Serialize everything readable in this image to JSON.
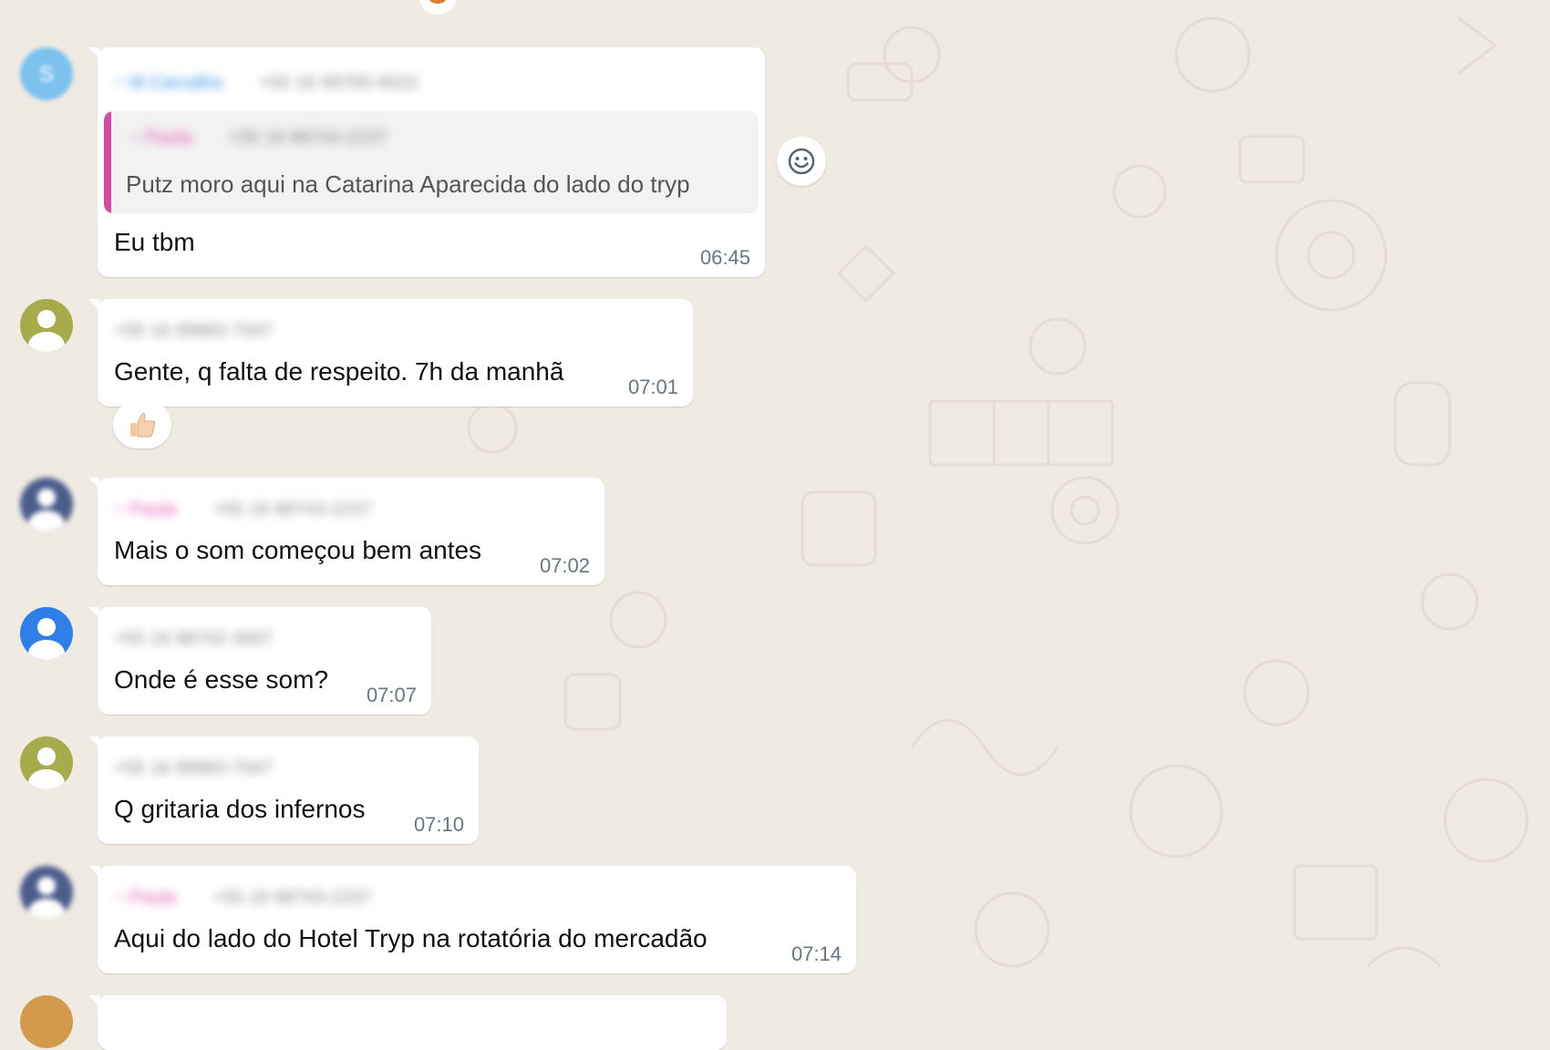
{
  "chat": {
    "messages": [
      {
        "id": 1,
        "sender_name": "~ M Carvalho",
        "sender_phone": "+55 16 99765-9022",
        "quote": {
          "author": "~ Paula",
          "author_phone": "+55 16 98743-2237",
          "text": "Putz moro aqui na Catarina Aparecida do lado do tryp"
        },
        "text": "Eu tbm",
        "time": "06:45"
      },
      {
        "id": 2,
        "sender_phone": "+55 16 99983-7047",
        "text": "Gente, q falta de respeito. 7h da manhã",
        "time": "07:01",
        "reaction": "thumbs-up"
      },
      {
        "id": 3,
        "sender_name": "~ Paula",
        "sender_phone": "+55 16 98743-2237",
        "text": "Mais o som começou bem antes",
        "time": "07:02"
      },
      {
        "id": 4,
        "sender_phone": "+55 16 98742-3007",
        "text": "Onde é esse som?",
        "time": "07:07"
      },
      {
        "id": 5,
        "sender_phone": "+55 16 99983-7047",
        "text": "Q gritaria dos infernos",
        "time": "07:10"
      },
      {
        "id": 6,
        "sender_name": "~ Paula",
        "sender_phone": "+55 16 98743-2237",
        "text": "Aqui do lado do Hotel Tryp na rotatória do mercadão",
        "time": "07:14"
      }
    ]
  },
  "colors": {
    "background": "#efeae2",
    "bubble": "#ffffff",
    "quote_accent": "#d44ba3",
    "time_text": "#667781"
  },
  "icons": {
    "react": "smiley-icon",
    "reaction": "thumbs-up-icon"
  }
}
